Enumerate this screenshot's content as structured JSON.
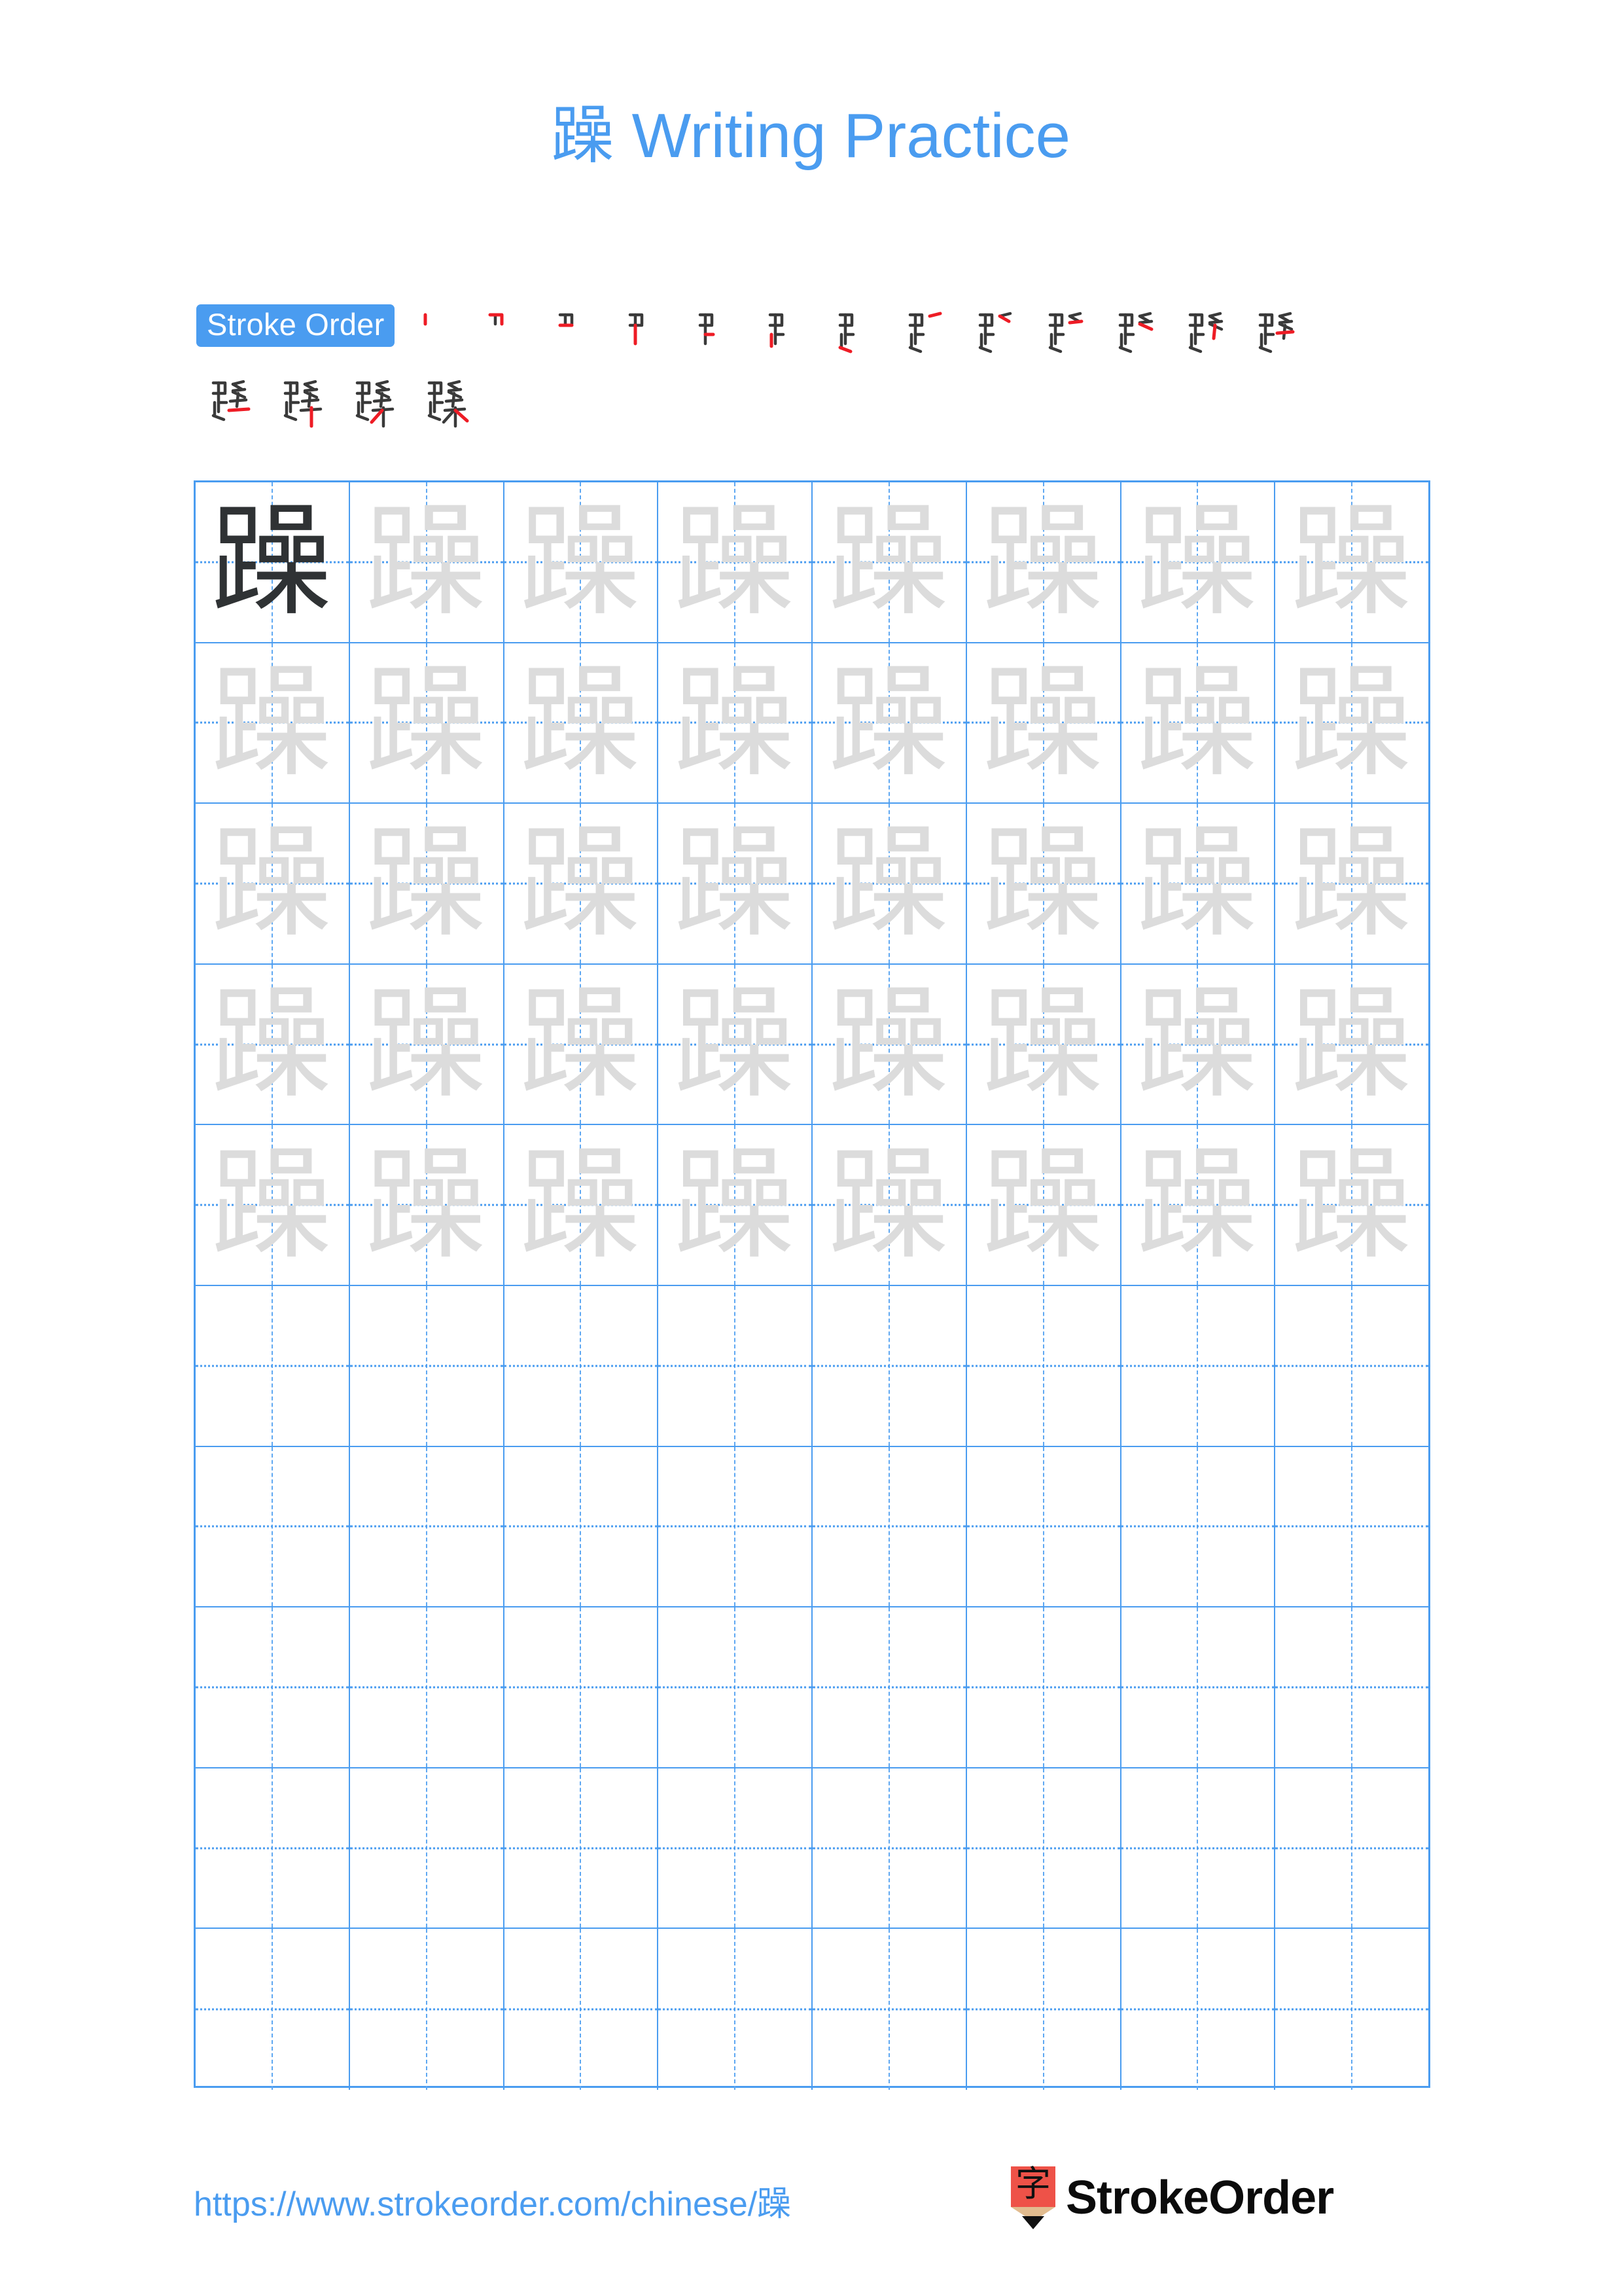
{
  "character": "躁",
  "title": {
    "character": "躁",
    "text": " Writing Practice",
    "full": "躁 Writing Practice",
    "color": "#4a9cf0"
  },
  "stroke_order": {
    "badge_label": "Stroke Order",
    "badge_bg": "#4a9cf0",
    "badge_text_color": "#ffffff",
    "total_strokes": 17,
    "new_stroke_color": "#ee1c25",
    "prior_stroke_color": "#3a3a3a",
    "steps": [
      {
        "index": 1,
        "glyph": "丨"
      },
      {
        "index": 2,
        "glyph": "冂"
      },
      {
        "index": 3,
        "glyph": "口"
      },
      {
        "index": 4,
        "glyph": "㕙"
      },
      {
        "index": 5,
        "glyph": "𧾷"
      },
      {
        "index": 6,
        "glyph": "𧾷"
      },
      {
        "index": 7,
        "glyph": "足"
      },
      {
        "index": 8,
        "glyph": "𧾷丿"
      },
      {
        "index": 9,
        "glyph": "𧾷㇇"
      },
      {
        "index": 10,
        "glyph": "𧾷乛"
      },
      {
        "index": 11,
        "glyph": "跘"
      },
      {
        "index": 12,
        "glyph": "跞"
      },
      {
        "index": 13,
        "glyph": "踩"
      },
      {
        "index": 14,
        "glyph": "蹂"
      },
      {
        "index": 15,
        "glyph": "蹂"
      },
      {
        "index": 16,
        "glyph": "躁"
      },
      {
        "index": 17,
        "glyph": "躁"
      }
    ],
    "row_split": [
      13,
      4
    ]
  },
  "practice_grid": {
    "columns": 8,
    "rows": 10,
    "filled_rows": 5,
    "empty_rows": 5,
    "first_cell_style": "dark",
    "trace_cell_style": "light",
    "grid_line_color": "#4a9cf0",
    "guide_line_color": "#5fa8f2",
    "dark_char_color": "#2f3234",
    "light_char_color": "#dcdcdc",
    "cell_character": "躁"
  },
  "footer": {
    "url": "https://www.strokeorder.com/chinese/躁",
    "url_color": "#4a9cf0",
    "brand_name": "StrokeOrder",
    "logo_glyph": "字",
    "logo_body_color": "#ee5248",
    "logo_wood_color": "#e2bc8f",
    "logo_tip_color": "#111111"
  }
}
